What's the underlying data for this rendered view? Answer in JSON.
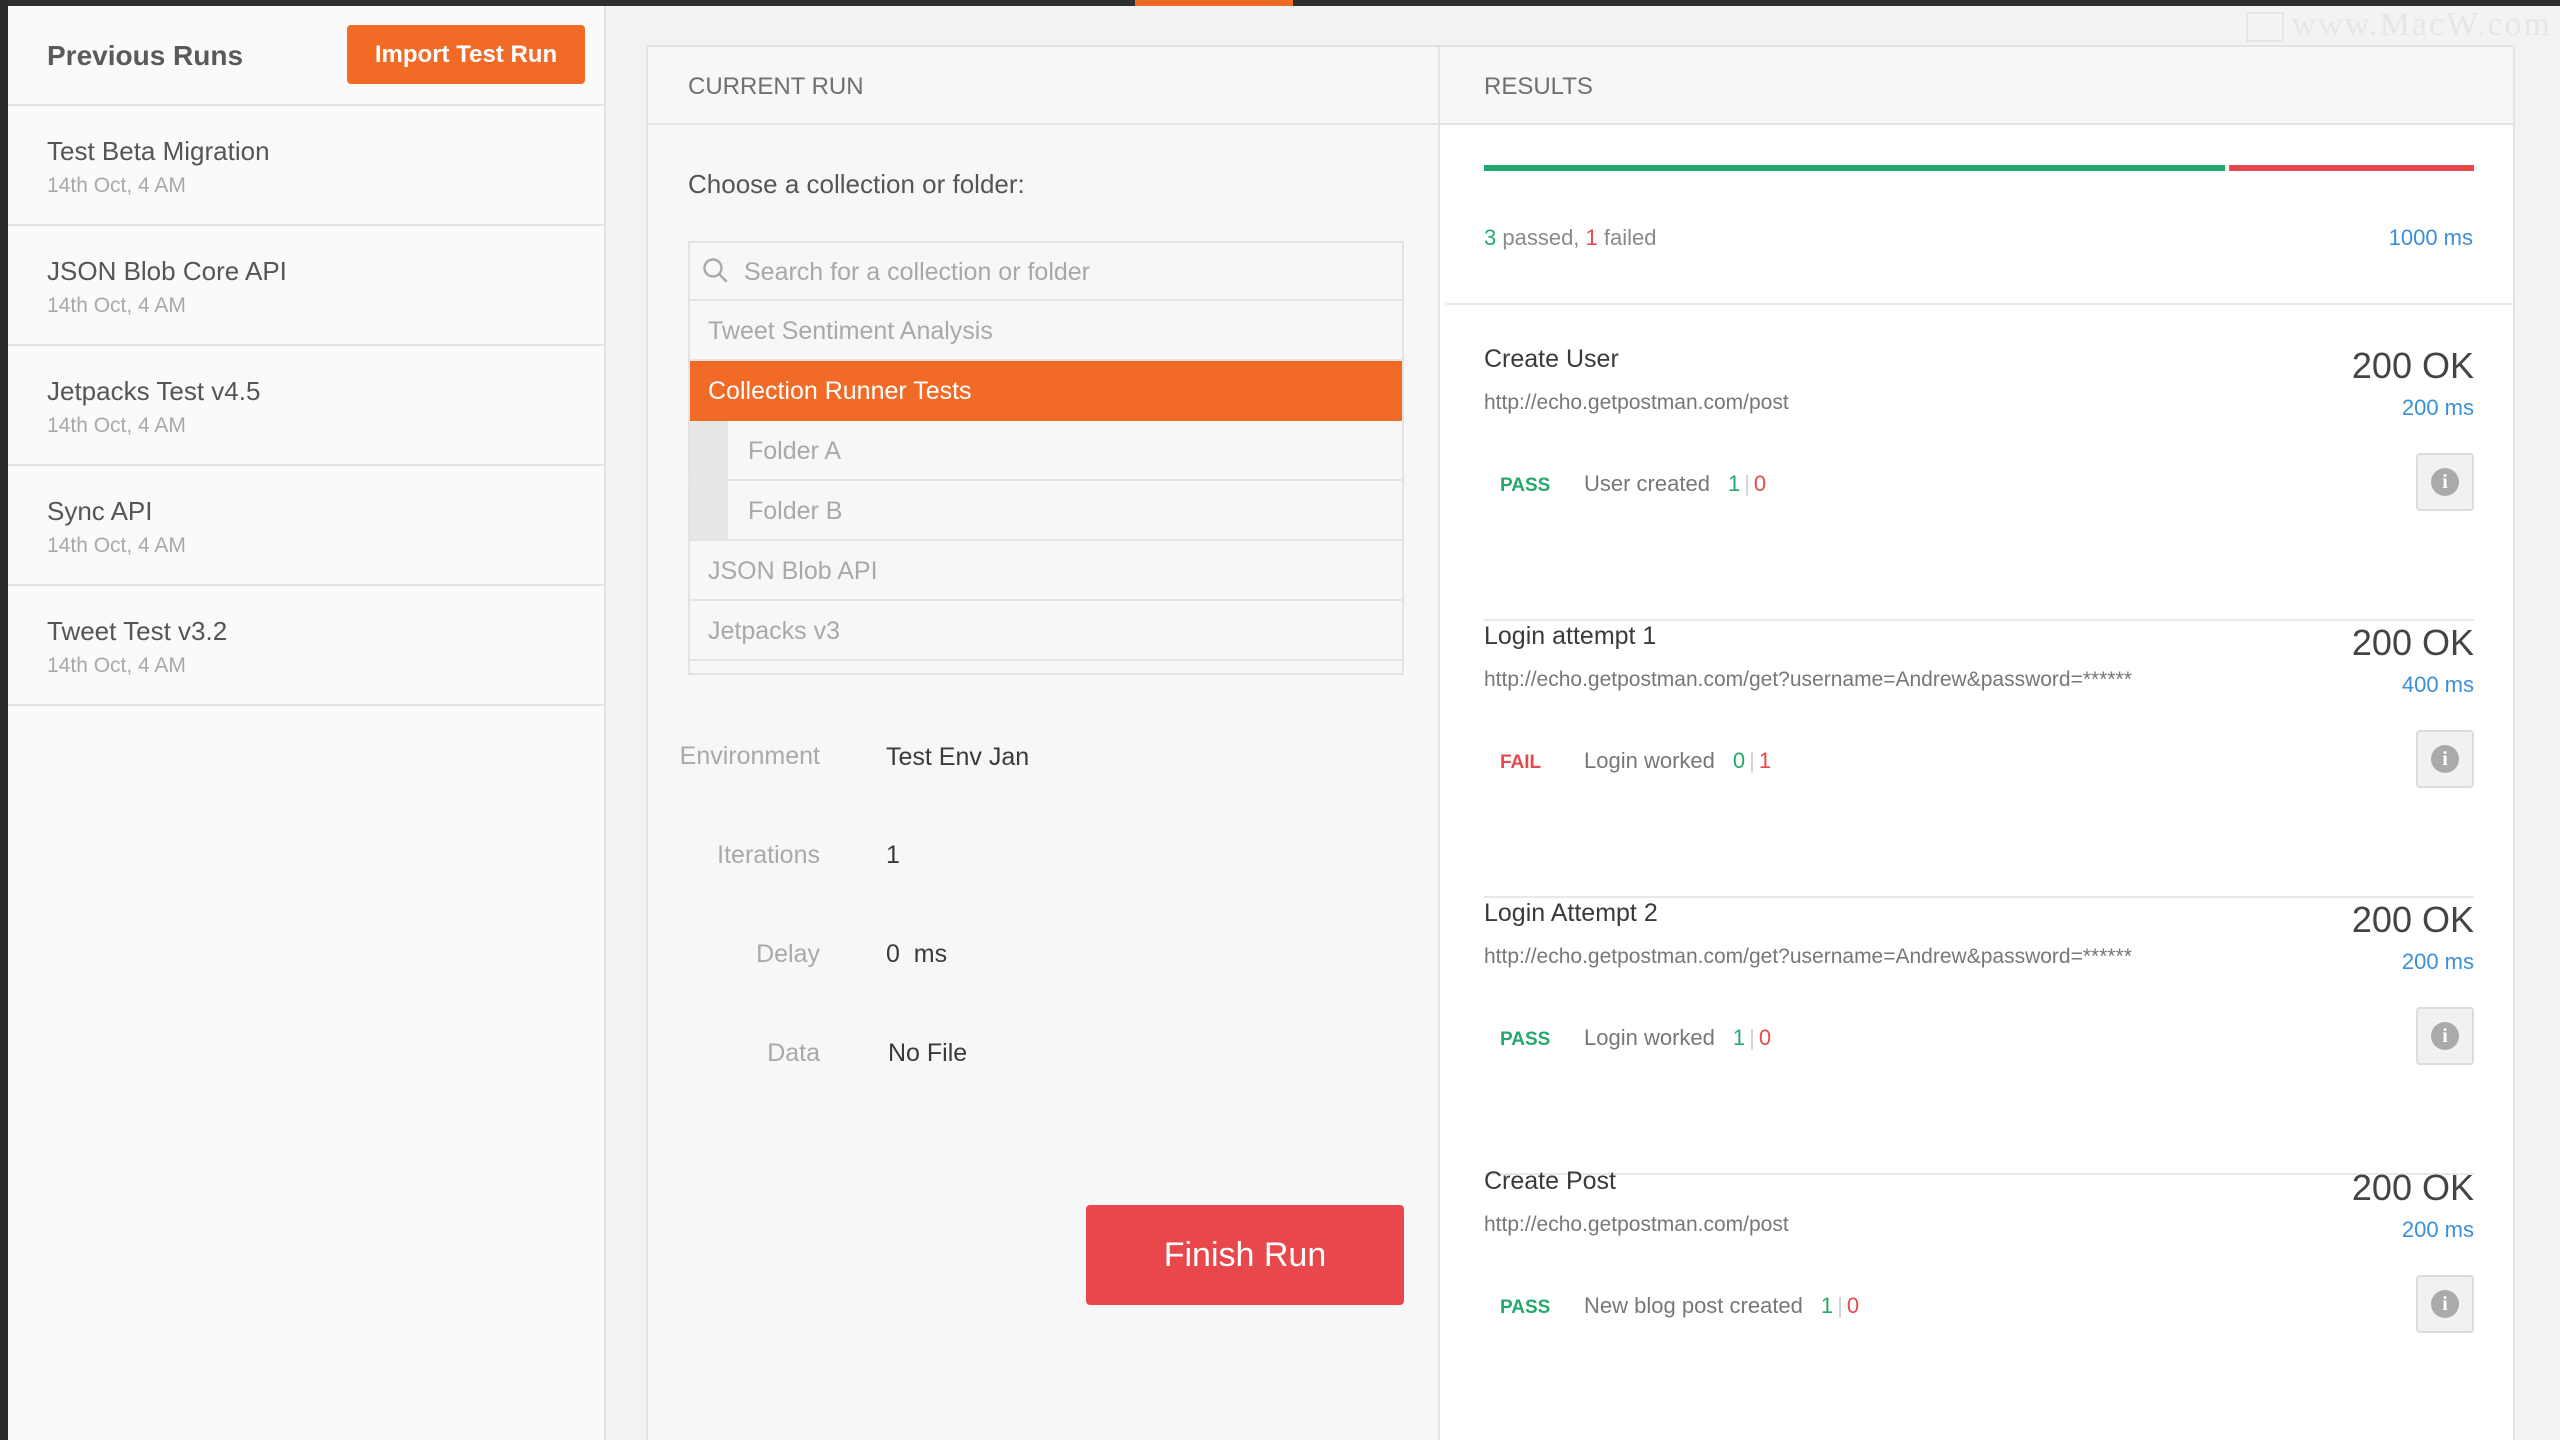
{
  "watermark": "www.MacW.com",
  "sidebar": {
    "title": "Previous Runs",
    "import_label": "Import Test Run",
    "runs": [
      {
        "name": "Test Beta Migration",
        "date": "14th Oct, 4 AM"
      },
      {
        "name": "JSON Blob Core API",
        "date": "14th Oct, 4 AM"
      },
      {
        "name": "Jetpacks Test v4.5",
        "date": "14th Oct, 4 AM"
      },
      {
        "name": "Sync API",
        "date": "14th Oct, 4 AM"
      },
      {
        "name": "Tweet Test v3.2",
        "date": "14th Oct, 4 AM"
      }
    ]
  },
  "current_run": {
    "heading": "CURRENT RUN",
    "choose_label": "Choose a collection or folder:",
    "search_placeholder": "Search for a collection or folder",
    "collections": [
      {
        "label": "Tweet Sentiment Analysis"
      },
      {
        "label": "Collection Runner Tests"
      },
      {
        "label": "Folder A"
      },
      {
        "label": "Folder B"
      },
      {
        "label": "JSON Blob API"
      },
      {
        "label": "Jetpacks v3"
      }
    ],
    "fields": {
      "environment": {
        "label": "Environment",
        "value": "Test Env Jan"
      },
      "iterations": {
        "label": "Iterations",
        "value": "1"
      },
      "delay": {
        "label": "Delay",
        "value": "0  ms"
      },
      "data": {
        "label": "Data",
        "value": "No File"
      }
    },
    "finish_label": "Finish Run"
  },
  "results": {
    "heading": "RESULTS",
    "passed_count": "3",
    "passed_word": " passed,",
    "failed_count": " 1",
    "failed_word": " failed",
    "total_time": "1000 ms",
    "pass_fraction": 0.75,
    "requests": [
      {
        "name": "Create User",
        "url": "http://echo.getpostman.com/post",
        "status": "200 OK",
        "time": "200 ms",
        "result": "PASS",
        "test": "User created",
        "pass": "1",
        "fail": "0"
      },
      {
        "name": "Login attempt 1",
        "url": "http://echo.getpostman.com/get?username=Andrew&password=******",
        "status": "200 OK",
        "time": "400 ms",
        "result": "FAIL",
        "test": "Login worked",
        "pass": "0",
        "fail": "1"
      },
      {
        "name": "Login Attempt 2",
        "url": "http://echo.getpostman.com/get?username=Andrew&password=******",
        "status": "200 OK",
        "time": "200 ms",
        "result": "PASS",
        "test": "Login worked",
        "pass": "1",
        "fail": "0"
      },
      {
        "name": "Create Post",
        "url": "http://echo.getpostman.com/post",
        "status": "200 OK",
        "time": "200 ms",
        "result": "PASS",
        "test": "New blog post created",
        "pass": "1",
        "fail": "0"
      }
    ]
  },
  "colors": {
    "accent": "#f26b26",
    "pass": "#25a86b",
    "fail": "#e8474c",
    "link": "#3b8fd8"
  }
}
